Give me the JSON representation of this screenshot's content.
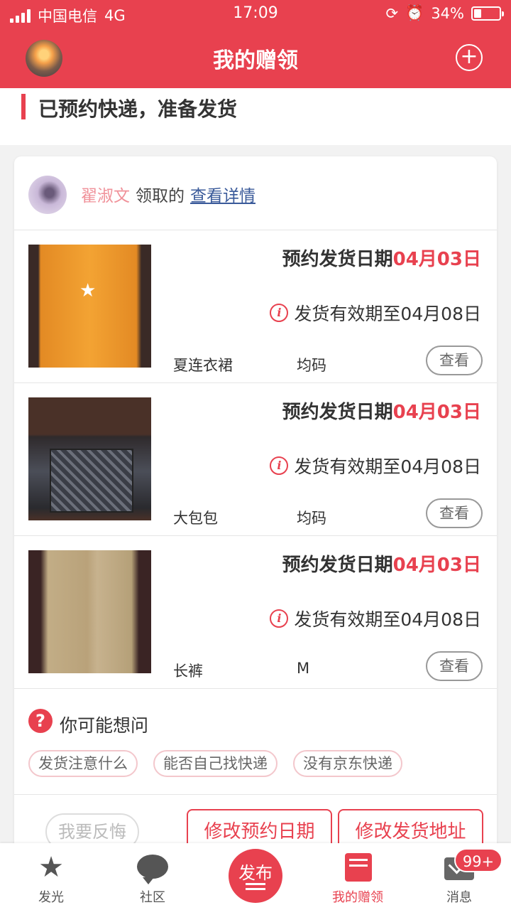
{
  "status_bar": {
    "carrier": "中国电信",
    "network": "4G",
    "time": "17:09",
    "battery": "34%"
  },
  "header": {
    "title": "我的赠领",
    "add_icon": "plus-circle-icon"
  },
  "section": {
    "title": "已预约快递，准备发货"
  },
  "claim": {
    "receiver_name": "翟淑文",
    "claim_text": "领取的",
    "detail_link": "查看详情"
  },
  "items": [
    {
      "date_label": "预约发货日期",
      "date_value": "04月03日",
      "validity": "发货有效期至04月08日",
      "name": "夏连衣裙",
      "size": "均码",
      "view_label": "查看"
    },
    {
      "date_label": "预约发货日期",
      "date_value": "04月03日",
      "validity": "发货有效期至04月08日",
      "name": "大包包",
      "size": "均码",
      "view_label": "查看"
    },
    {
      "date_label": "预约发货日期",
      "date_value": "04月03日",
      "validity": "发货有效期至04月08日",
      "name": "长裤",
      "size": "M",
      "view_label": "查看"
    }
  ],
  "faq": {
    "icon": "?",
    "title": "你可能想问",
    "chips": [
      "发货注意什么",
      "能否自己找快递",
      "没有京东快递"
    ]
  },
  "actions": {
    "regret": "我要反悔",
    "modify_date": "修改预约日期",
    "modify_address": "修改发货地址"
  },
  "tabbar": {
    "tabs": [
      {
        "label": "发光",
        "icon": "star-icon"
      },
      {
        "label": "社区",
        "icon": "chat-bubble-icon"
      },
      {
        "label": "我的赠领",
        "icon": "book-icon",
        "active": true
      },
      {
        "label": "消息",
        "icon": "mail-icon"
      }
    ],
    "publish": "发布",
    "badge": "99+"
  },
  "colors": {
    "accent": "#e8414f",
    "link": "#3a5a9a",
    "receiver": "#f0929a"
  }
}
